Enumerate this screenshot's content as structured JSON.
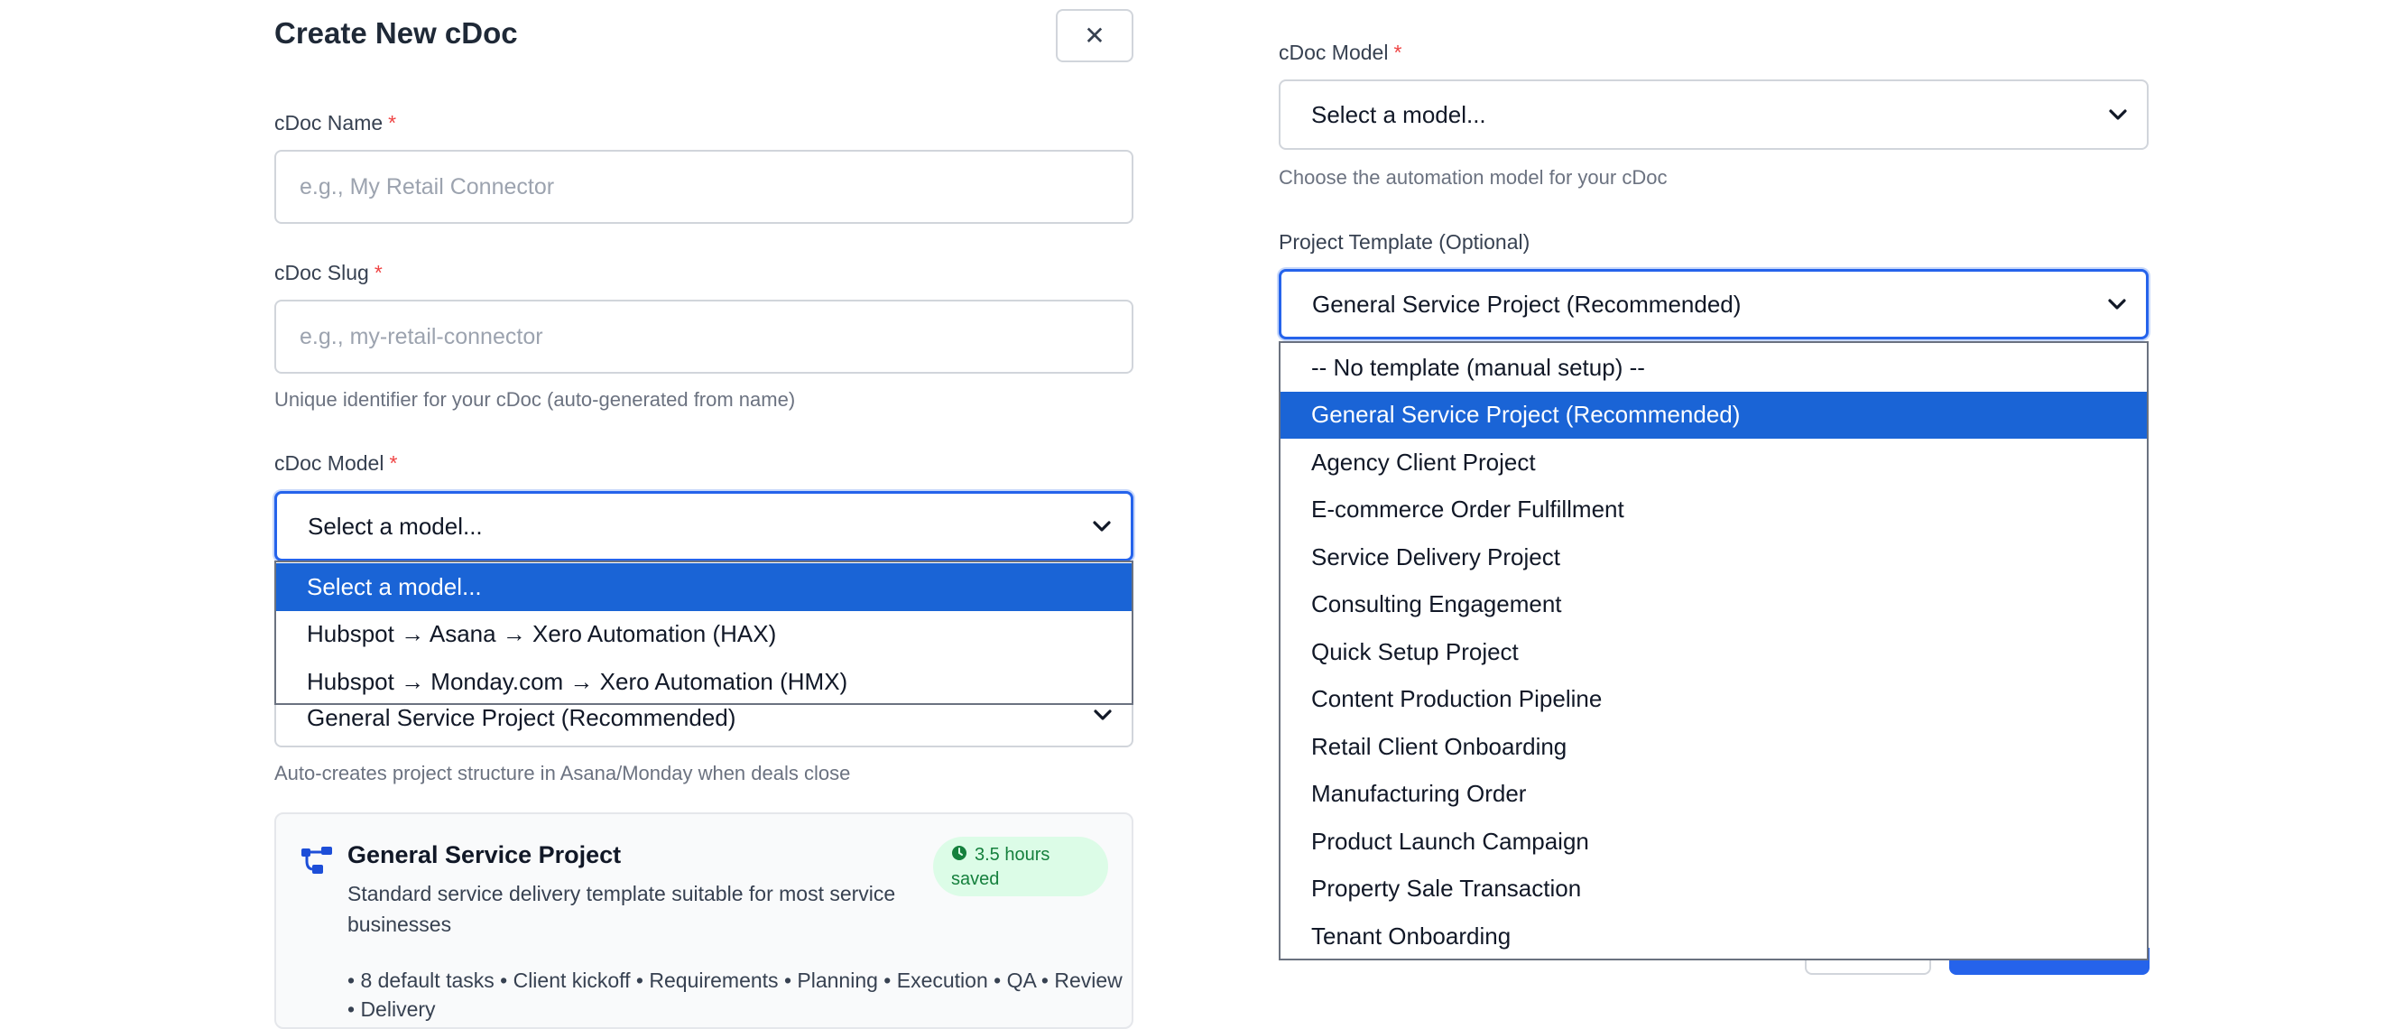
{
  "form": {
    "title": "Create New cDoc",
    "close_glyph": "✕",
    "required_mark": "*",
    "name": {
      "label": "cDoc Name",
      "placeholder": "e.g., My Retail Connector"
    },
    "slug": {
      "label": "cDoc Slug",
      "placeholder": "e.g., my-retail-connector",
      "help": "Unique identifier for your cDoc (auto-generated from name)"
    },
    "model": {
      "label": "cDoc Model",
      "value": "Select a model...",
      "options": [
        "Select a model...",
        "Hubspot → Asana → Xero Automation (HAX)",
        "Hubspot → Monday.com → Xero Automation (HMX)"
      ],
      "selected_index": 0
    },
    "template": {
      "value": "General Service Project (Recommended)",
      "help": "Auto-creates project structure in Asana/Monday when deals close"
    },
    "card": {
      "title": "General Service Project",
      "description": "Standard service delivery template suitable for most service businesses",
      "badge_line1": "3.5 hours",
      "badge_line2": "saved",
      "tasks": "• 8 default tasks • Client kickoff • Requirements • Planning • Execution • QA • Review • Delivery"
    }
  },
  "right": {
    "model": {
      "label": "cDoc Model",
      "value": "Select a model...",
      "help": "Choose the automation model for your cDoc"
    },
    "template": {
      "label": "Project Template (Optional)",
      "value": "General Service Project (Recommended)",
      "options": [
        "-- No template (manual setup) --",
        "General Service Project (Recommended)",
        "Agency Client Project",
        "E-commerce Order Fulfillment",
        "Service Delivery Project",
        "Consulting Engagement",
        "Quick Setup Project",
        "Content Production Pipeline",
        "Retail Client Onboarding",
        "Manufacturing Order",
        "Product Launch Campaign",
        "Property Sale Transaction",
        "Tenant Onboarding"
      ],
      "selected_index": 1
    }
  },
  "colors": {
    "accent": "#2563eb",
    "selected_option": "#1a64d6",
    "required": "#ef4444",
    "badge_bg": "#dcfce7",
    "badge_text": "#15803d"
  },
  "icons": {
    "close": "close-icon",
    "chevron": "chevron-down-icon",
    "workflow": "workflow-icon",
    "clock": "clock-icon"
  }
}
